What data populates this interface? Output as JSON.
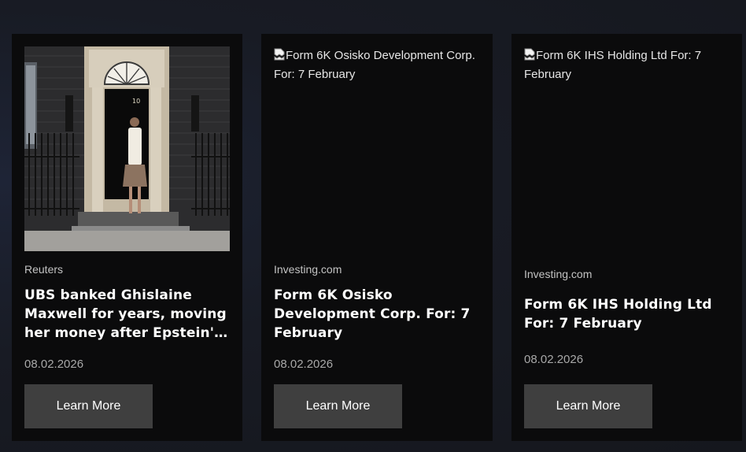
{
  "cards": [
    {
      "source": "Reuters",
      "title": "UBS banked Ghislaine Maxwell for years, moving her money after Epstein's death",
      "date": "08.02.2026",
      "button_label": "Learn More",
      "image_alt": ""
    },
    {
      "source": "Investing.com",
      "title": "Form 6K Osisko Development Corp. For: 7 February",
      "date": "08.02.2026",
      "button_label": "Learn More",
      "image_alt": "Form 6K Osisko Development Corp. For: 7 February"
    },
    {
      "source": "Investing.com",
      "title": "Form 6K IHS Holding Ltd For: 7 February",
      "date": "08.02.2026",
      "button_label": "Learn More",
      "image_alt": "Form 6K IHS Holding Ltd For: 7 February"
    }
  ],
  "colors": {
    "card_bg": "#0b0b0c",
    "button_bg": "#3f3f3f",
    "page_bg": "#181b24"
  }
}
